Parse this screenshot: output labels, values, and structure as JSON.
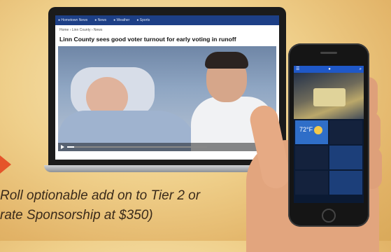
{
  "caption": {
    "line1": "Roll optionable add on to Tier 2 or",
    "line2": "rate Sponsorship at $350)"
  },
  "laptop": {
    "nav_items": [
      "● Hometown News",
      "● News",
      "● Weather",
      "● Sports"
    ],
    "breadcrumb": "Home › Linn County › News",
    "headline": "Linn County sees good voter turnout for early voting in runoff",
    "video_progress": 0.05
  },
  "phone": {
    "weather_temp": "72°F"
  },
  "colors": {
    "arrow": "#e5542a",
    "site_nav": "#1d3f86",
    "app_nav": "#1f58c8"
  }
}
